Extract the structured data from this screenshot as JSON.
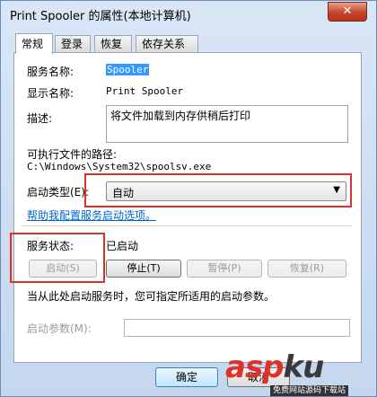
{
  "window": {
    "title": "Print Spooler 的属性(本地计算机)",
    "close_label": "✕"
  },
  "tabs": [
    {
      "label": "常规"
    },
    {
      "label": "登录"
    },
    {
      "label": "恢复"
    },
    {
      "label": "依存关系"
    }
  ],
  "general": {
    "service_name_label": "服务名称:",
    "service_name_value": "Spooler",
    "display_name_label": "显示名称:",
    "display_name_value": "Print Spooler",
    "description_label": "描述:",
    "description_value": "将文件加载到内存供稍后打印",
    "path_label": "可执行文件的路径:",
    "path_value": "C:\\Windows\\System32\\spoolsv.exe",
    "startup_type_label": "启动类型(E):",
    "startup_type_value": "自动",
    "help_link": "帮助我配置服务启动选项。",
    "status_label": "服务状态:",
    "status_value": "已启动",
    "buttons": {
      "start": "启动(S)",
      "stop": "停止(T)",
      "pause": "暂停(P)",
      "resume": "恢复(R)"
    },
    "hint_text": "当从此处启动服务时，您可指定所适用的启动参数。",
    "start_params_label": "启动参数(M):",
    "start_params_value": ""
  },
  "footer": {
    "ok_label": "确定",
    "cancel_label": "取消"
  },
  "watermark": {
    "brand_a": "asp",
    "brand_b": "ku",
    "subtitle": "免费网站源码下载站"
  },
  "colors": {
    "highlight_box": "#e0302a",
    "link": "#0066cc",
    "selection": "#3399ff"
  }
}
